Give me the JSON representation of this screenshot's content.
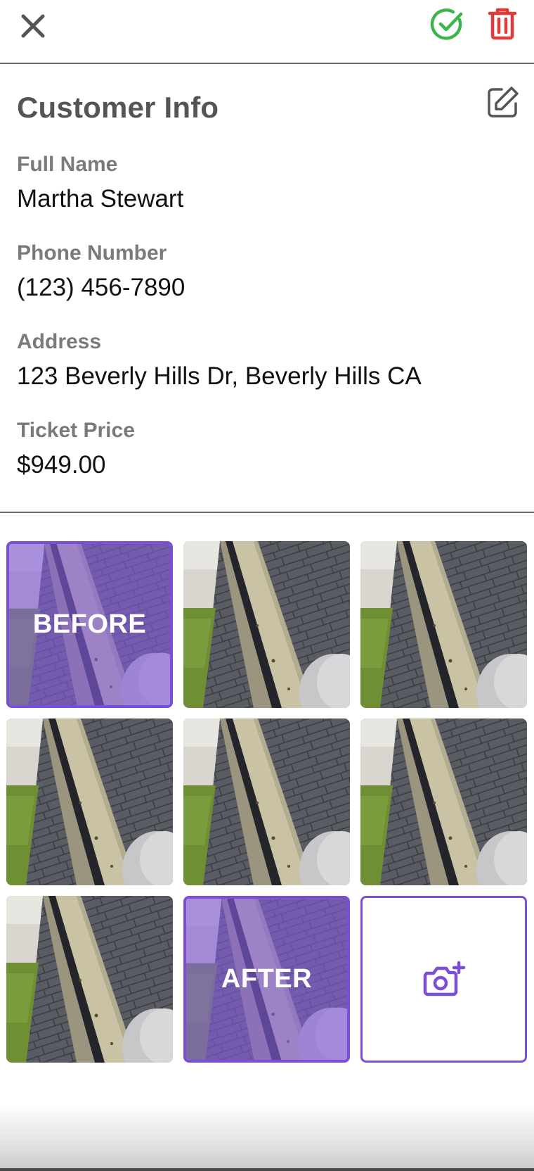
{
  "header": {
    "close_icon": "close-icon",
    "complete_icon": "check-circle-icon",
    "delete_icon": "trash-icon"
  },
  "customer_info": {
    "title": "Customer Info",
    "edit_icon": "edit-icon",
    "fields": [
      {
        "label": "Full Name",
        "value": "Martha Stewart"
      },
      {
        "label": "Phone Number",
        "value": "(123) 456-7890"
      },
      {
        "label": "Address",
        "value": "123 Beverly Hills Dr, Beverly Hills CA"
      },
      {
        "label": "Ticket Price",
        "value": "$949.00"
      }
    ]
  },
  "photos": {
    "before_label": "BEFORE",
    "after_label": "AFTER",
    "add_photo_icon": "camera-plus-icon"
  },
  "colors": {
    "accent": "#7c4dd8",
    "success": "#3db54a",
    "danger": "#e03a3a",
    "label_gray": "#7a7a7a"
  }
}
